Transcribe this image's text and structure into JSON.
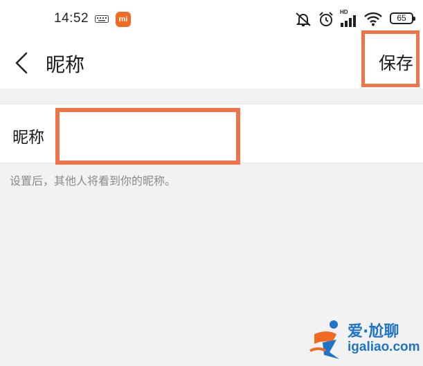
{
  "status_bar": {
    "time": "14:52",
    "mi_badge": "mi",
    "battery": "65",
    "network_badge": "HD",
    "icons": [
      "keyboard-icon",
      "mi-icon",
      "mute-icon",
      "alarm-icon",
      "signal-icon",
      "wifi-icon",
      "battery-icon"
    ]
  },
  "header": {
    "back_icon": "chevron-left-icon",
    "title": "昵称",
    "save_label": "保存"
  },
  "form": {
    "label": "昵称",
    "value": "",
    "placeholder": ""
  },
  "hint": "设置后，其他人将看到你的昵称。",
  "watermark": {
    "text_cn": "爱·尬聊",
    "url": "igaliao.com"
  },
  "colors": {
    "highlight": "#ef7549",
    "watermark": "#1f74c9",
    "mi_brand": "#f06a24"
  }
}
